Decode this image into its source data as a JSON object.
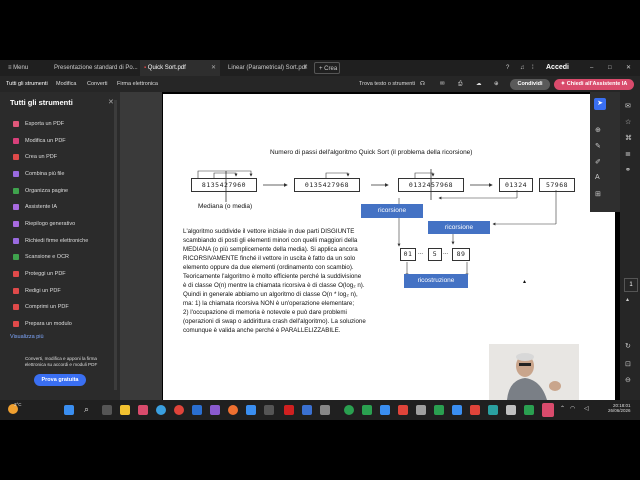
{
  "titlebar": {
    "menu_label": "Menu",
    "tabs": [
      {
        "label": "Presentazione standard di Po..."
      },
      {
        "label": "Quick Sort.pdf"
      },
      {
        "label": "Linear (Parametrical) Sort.pdf"
      }
    ],
    "new_tab_label": "Crea",
    "signin_label": "Accedi"
  },
  "toolbar": {
    "items": [
      "Tutti gli strumenti",
      "Modifica",
      "Converti",
      "Firma elettronica"
    ],
    "find_label": "Trova testo o strumenti",
    "share_label": "Condividi",
    "ai_label": "Chiedi all'Assistente IA"
  },
  "sidebar": {
    "title": "Tutti gli strumenti",
    "items": [
      {
        "label": "Esporta un PDF",
        "color": "#e0587a"
      },
      {
        "label": "Modifica un PDF",
        "color": "#d9407a"
      },
      {
        "label": "Crea un PDF",
        "color": "#e04a4a"
      },
      {
        "label": "Combina più file",
        "color": "#9a6ae0"
      },
      {
        "label": "Organizza pagine",
        "color": "#3fa34d"
      },
      {
        "label": "Assistente IA",
        "color": "#a86ae0"
      },
      {
        "label": "Riepilogo generativo",
        "color": "#a86ae0"
      },
      {
        "label": "Richiedi firme elettroniche",
        "color": "#9a6ae0"
      },
      {
        "label": "Scansione e OCR",
        "color": "#3fa34d"
      },
      {
        "label": "Proteggi un PDF",
        "color": "#e04a4a"
      },
      {
        "label": "Redigi un PDF",
        "color": "#e04a4a"
      },
      {
        "label": "Comprimi un PDF",
        "color": "#e04a4a"
      },
      {
        "label": "Prepara un modulo",
        "color": "#e04a4a"
      }
    ],
    "show_all": "Visualizza più",
    "promo_text": "Converti, modifica e apponi la firma elettronica su accordi e moduli PDF",
    "promo_button": "Prova gratuita"
  },
  "document": {
    "heading": "Numero di passi dell'algoritmo Quick Sort (il problema della ricorsione)",
    "arrays": [
      "8135427960",
      "0135427968",
      "0132457968",
      "01324",
      "57968"
    ],
    "median_label": "Mediana (o media)",
    "ricorsione_label": "ricorsione",
    "ricorsione2_label": "ricorsione",
    "small_boxes": [
      "01",
      "...",
      "5",
      "...",
      "89"
    ],
    "ricostruzione_label": "ricostruzione",
    "paragraph": [
      "L'algoritmo suddivide il vettore iniziale in due parti DISGIUNTE",
      "scambiando di posti gli elementi minori con quelli maggiori della",
      "MEDIANA (o più semplicemente della media). Si applica ancora",
      "RICORSIVAMENTE finché il vettore in uscita è fatto da un solo",
      "elemento oppure da due elementi (ordinamento con scambio).",
      "Teoricamente l'algoritmo è molto efficiente perché la suddivisione",
      "è di classe O(n) mentre la chiamata ricorsiva è di classe O(log₂ n).",
      "Quindi in generale abbiamo un algoritmo di classe O(n * log₂ n),",
      "ma: 1) la chiamata ricorsiva NON è un'operazione elementare;",
      "2) l'occupazione di memoria è notevole e può dare problemi",
      "(operazioni di swap o addirittura crash dell'algoritmo). La soluzione",
      "comunque è valida anche perché è PARALLELIZZABILE."
    ]
  },
  "rightbar": {
    "page_number": "1"
  },
  "taskbar": {
    "weather": "3°C",
    "time": "20:18:01",
    "date": "26/06/2026"
  },
  "colors": {
    "accent_blue": "#4472c4",
    "ai_button": "#d94b6c",
    "share_button": "#5a5a5a"
  }
}
